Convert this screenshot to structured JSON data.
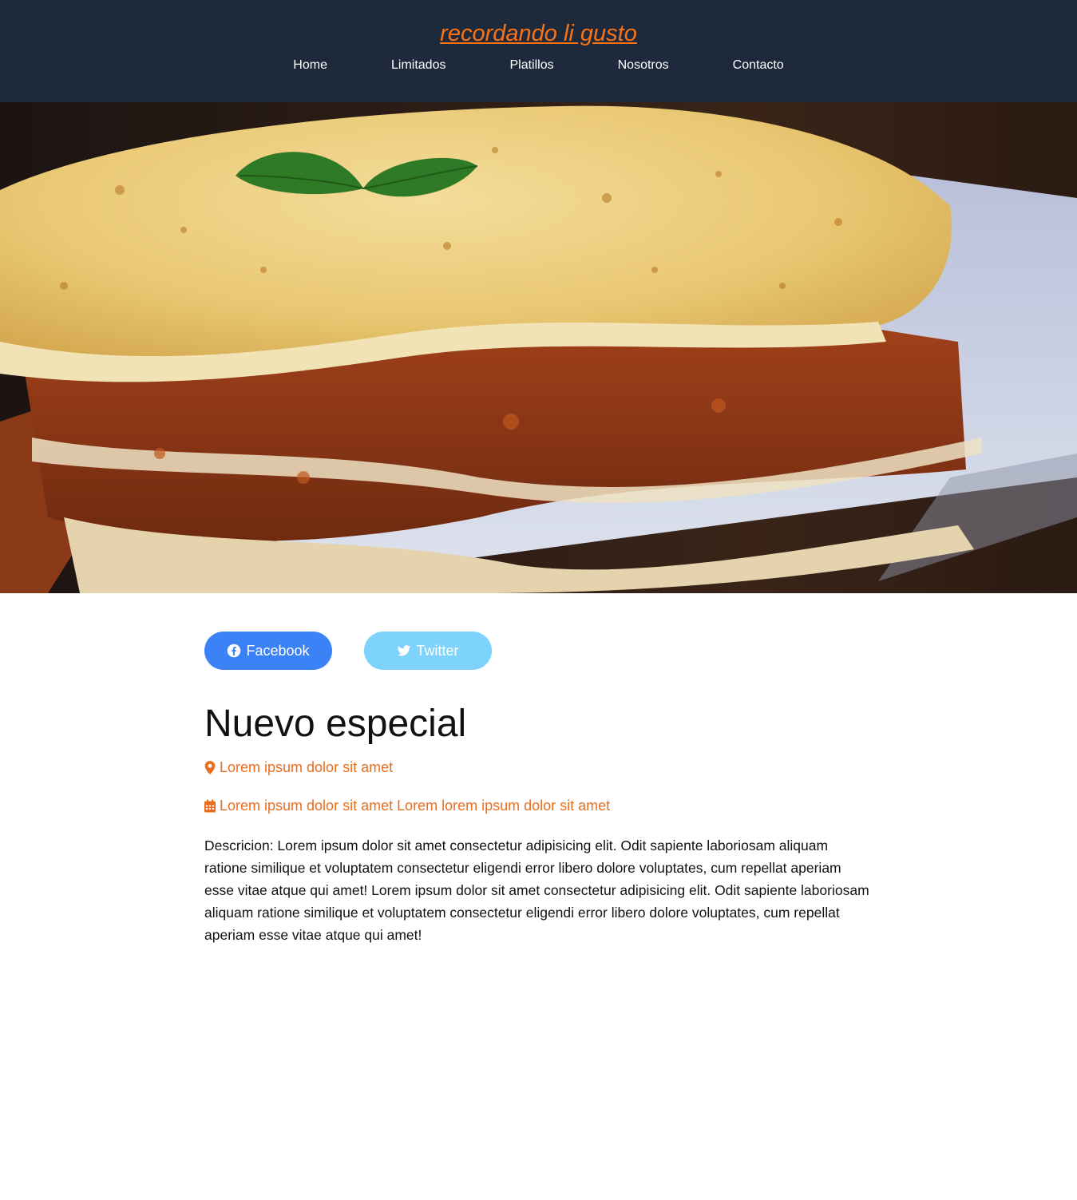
{
  "header": {
    "brand": "recordando li gusto",
    "nav": [
      "Home",
      "Limitados",
      "Platillos",
      "Nosotros",
      "Contacto"
    ]
  },
  "hero": {
    "alt": "lasagna"
  },
  "social": {
    "facebook_label": "Facebook",
    "twitter_label": "Twitter"
  },
  "article": {
    "title": "Nuevo especial",
    "location": "Lorem ipsum dolor sit amet",
    "date": "Lorem ipsum dolor sit amet Lorem lorem ipsum dolor sit amet",
    "description": "Descricion: Lorem ipsum dolor sit amet consectetur adipisicing elit. Odit sapiente laboriosam aliquam ratione similique et voluptatem consectetur eligendi error libero dolore voluptates, cum repellat aperiam esse vitae atque qui amet! Lorem ipsum dolor sit amet consectetur adipisicing elit. Odit sapiente laboriosam aliquam ratione similique et voluptatem consectetur eligendi error libero dolore voluptates, cum repellat aperiam esse vitae atque qui amet!"
  },
  "colors": {
    "header_bg": "#1e293b",
    "accent": "#f97316",
    "facebook": "#3b82f6",
    "twitter": "#7dd3fc"
  },
  "icons": [
    "facebook-icon",
    "twitter-icon",
    "map-pin-icon",
    "calendar-icon"
  ]
}
